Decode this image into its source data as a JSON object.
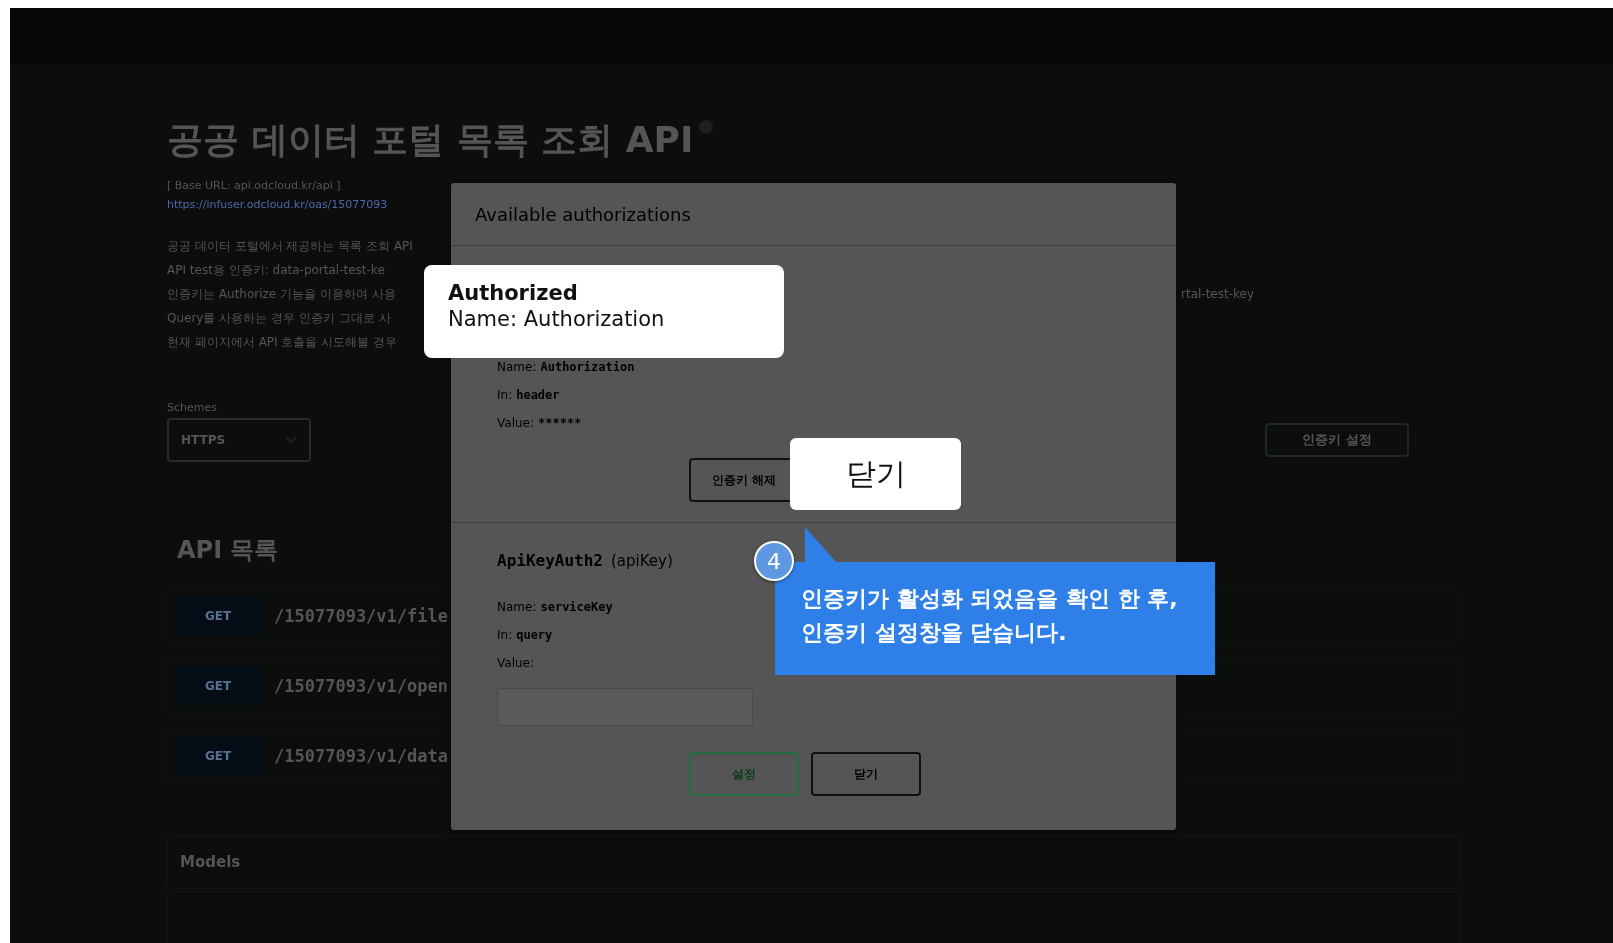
{
  "page": {
    "title": "공공 데이터 포털 목록 조회 API",
    "base_url": "[ Base URL: api.odcloud.kr/api ]",
    "spec_link": "https://infuser.odcloud.kr/oas/15077093",
    "description": [
      {
        "left": "공공 데이터 포털에서 제공하는 목록 조회 API"
      },
      {
        "left": "API test용 인증키: data-portal-test-ke"
      },
      {
        "left": "인증키는 Authorize 기능을 이용하여 사용",
        "right": "rtal-test-key"
      },
      {
        "left": "Query를 사용하는 경우 인증키 그대로 사"
      },
      {
        "left": "현재 페이지에서 API 호출을 시도해볼 경우"
      }
    ],
    "schemes": {
      "label": "Schemes",
      "value": "HTTPS"
    },
    "authorize_button": "인증키 설정",
    "api_list": {
      "heading": "API 목록",
      "rows": [
        {
          "method": "GET",
          "path": "/15077093/v1/file"
        },
        {
          "method": "GET",
          "path": "/15077093/v1/open"
        },
        {
          "method": "GET",
          "path": "/15077093/v1/data"
        }
      ]
    },
    "models": {
      "heading": "Models"
    }
  },
  "modal": {
    "title": "Available authorizations",
    "sections": [
      {
        "kind": "authorized",
        "fields": [
          {
            "label": "Name:",
            "value": "Authorization"
          },
          {
            "label": "In:",
            "value": "header"
          },
          {
            "label": "Value:",
            "value": "******"
          }
        ],
        "buttons": [
          {
            "label": "인증키 해제",
            "kind": "secondary"
          }
        ]
      },
      {
        "kind": "unauthorized",
        "heading": "ApiKeyAuth2",
        "type": "(apiKey)",
        "fields": [
          {
            "label": "Name:",
            "value": "serviceKey"
          },
          {
            "label": "In:",
            "value": "query"
          },
          {
            "label": "Value:"
          }
        ],
        "buttons": [
          {
            "label": "설정",
            "kind": "primary"
          },
          {
            "label": "닫기",
            "kind": "secondary"
          }
        ]
      }
    ]
  },
  "callouts": [
    {
      "kind": "card",
      "title": "Authorized",
      "text": "Name: Authorization"
    },
    {
      "kind": "button",
      "text": "닫기"
    },
    {
      "kind": "bubble",
      "step": "4",
      "lines": [
        "인증키가 활성화 되었음을 확인 한 후,",
        "인증키 설정창을 닫습니다."
      ]
    }
  ]
}
